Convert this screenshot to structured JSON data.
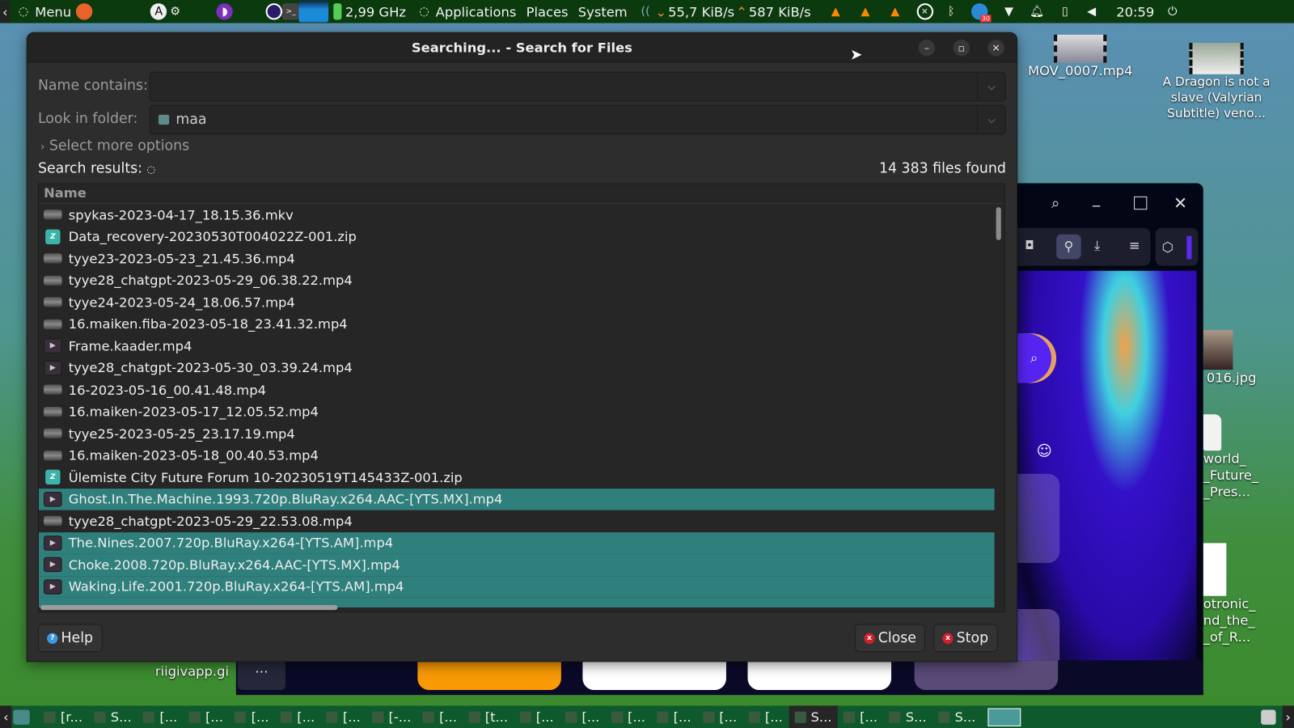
{
  "top_panel": {
    "menu_label": "Menu",
    "cpu_freq": "2,99 GHz",
    "applications_label": "Applications",
    "places_label": "Places",
    "system_label": "System",
    "net_down": "55,7 KiB/s",
    "net_up": "587 KiB/s",
    "notification_badge": "30",
    "clock": "20:59"
  },
  "dialog": {
    "title": "Searching... - Search for Files",
    "name_contains_label": "Name contains:",
    "name_contains_value": "",
    "look_in_label": "Look in folder:",
    "look_in_value": "maa",
    "more_options_label": "Select more options",
    "search_results_label": "Search results:",
    "files_found": "14 383 files found",
    "column_name": "Name",
    "files": [
      {
        "name": "spykas-2023-04-17_18.15.36.mkv",
        "icon": "thumb",
        "selected": false
      },
      {
        "name": "Data_recovery-20230530T004022Z-001.zip",
        "icon": "zip",
        "selected": false
      },
      {
        "name": "tyye23-2023-05-23_21.45.36.mp4",
        "icon": "thumb",
        "selected": false
      },
      {
        "name": "tyye28_chatgpt-2023-05-29_06.38.22.mp4",
        "icon": "thumb",
        "selected": false
      },
      {
        "name": "tyye24-2023-05-24_18.06.57.mp4",
        "icon": "thumb",
        "selected": false
      },
      {
        "name": "16.maiken.fiba-2023-05-18_23.41.32.mp4",
        "icon": "thumb",
        "selected": false
      },
      {
        "name": "Frame.kaader.mp4",
        "icon": "video",
        "selected": false
      },
      {
        "name": "tyye28_chatgpt-2023-05-30_03.39.24.mp4",
        "icon": "video",
        "selected": false
      },
      {
        "name": "16-2023-05-16_00.41.48.mp4",
        "icon": "thumb",
        "selected": false
      },
      {
        "name": "16.maiken-2023-05-17_12.05.52.mp4",
        "icon": "thumb",
        "selected": false
      },
      {
        "name": "tyye25-2023-05-25_23.17.19.mp4",
        "icon": "thumb",
        "selected": false
      },
      {
        "name": "16.maiken-2023-05-18_00.40.53.mp4",
        "icon": "thumb",
        "selected": false
      },
      {
        "name": "Ülemiste City Future Forum 10-20230519T145433Z-001.zip",
        "icon": "zip",
        "selected": false
      },
      {
        "name": "Ghost.In.The.Machine.1993.720p.BluRay.x264.AAC-[YTS.MX].mp4",
        "icon": "video",
        "selected": true
      },
      {
        "name": "tyye28_chatgpt-2023-05-29_22.53.08.mp4",
        "icon": "thumb",
        "selected": false
      },
      {
        "name": "The.Nines.2007.720p.BluRay.x264-[YTS.AM].mp4",
        "icon": "video",
        "selected": true
      },
      {
        "name": "Choke.2008.720p.BluRay.x264.AAC-[YTS.MX].mp4",
        "icon": "video",
        "selected": true
      },
      {
        "name": "Waking.Life.2001.720p.BluRay.x264-[YTS.AM].mp4",
        "icon": "video",
        "selected": true
      }
    ],
    "help_label": "Help",
    "close_label": "Close",
    "stop_label": "Stop"
  },
  "desktop": {
    "icons": [
      "MOV_0007.mp4",
      "A Dragon is not a slave (Valyrian Subtitle) veno...",
      "016.jpg",
      "world_ _Future_ _Pres...",
      "otronic_ nd_the_ _of_R...",
      "riigivapp.gi"
    ]
  },
  "taskbar": {
    "items": [
      "[r...",
      "S...",
      "[...",
      "[...",
      "[...",
      "[...",
      "[...",
      "[-...",
      "[...",
      "[t...",
      "[...",
      "[...",
      "[...",
      "[...",
      "[...",
      "[...",
      "S...",
      "[...",
      "S...",
      "S..."
    ]
  },
  "colors": {
    "selection": "#2f7f7d",
    "panel": "#0c3a0f",
    "taskbar": "#0e5a2c"
  }
}
